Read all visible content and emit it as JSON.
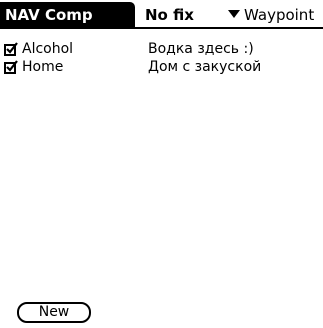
{
  "titlebar": {
    "app_title": "NAV Comp",
    "status": "No fix",
    "category": "Waypoint"
  },
  "icons": {
    "category_dropdown": "triangle-down-icon",
    "checkbox": "checkbox-checked-icon"
  },
  "waypoints": [
    {
      "name": "Alcohol",
      "note": "Водка здесь :)",
      "checked": true
    },
    {
      "name": "Home",
      "note": "Дом с закуской",
      "checked": true
    }
  ],
  "buttons": {
    "new_label": "New"
  }
}
